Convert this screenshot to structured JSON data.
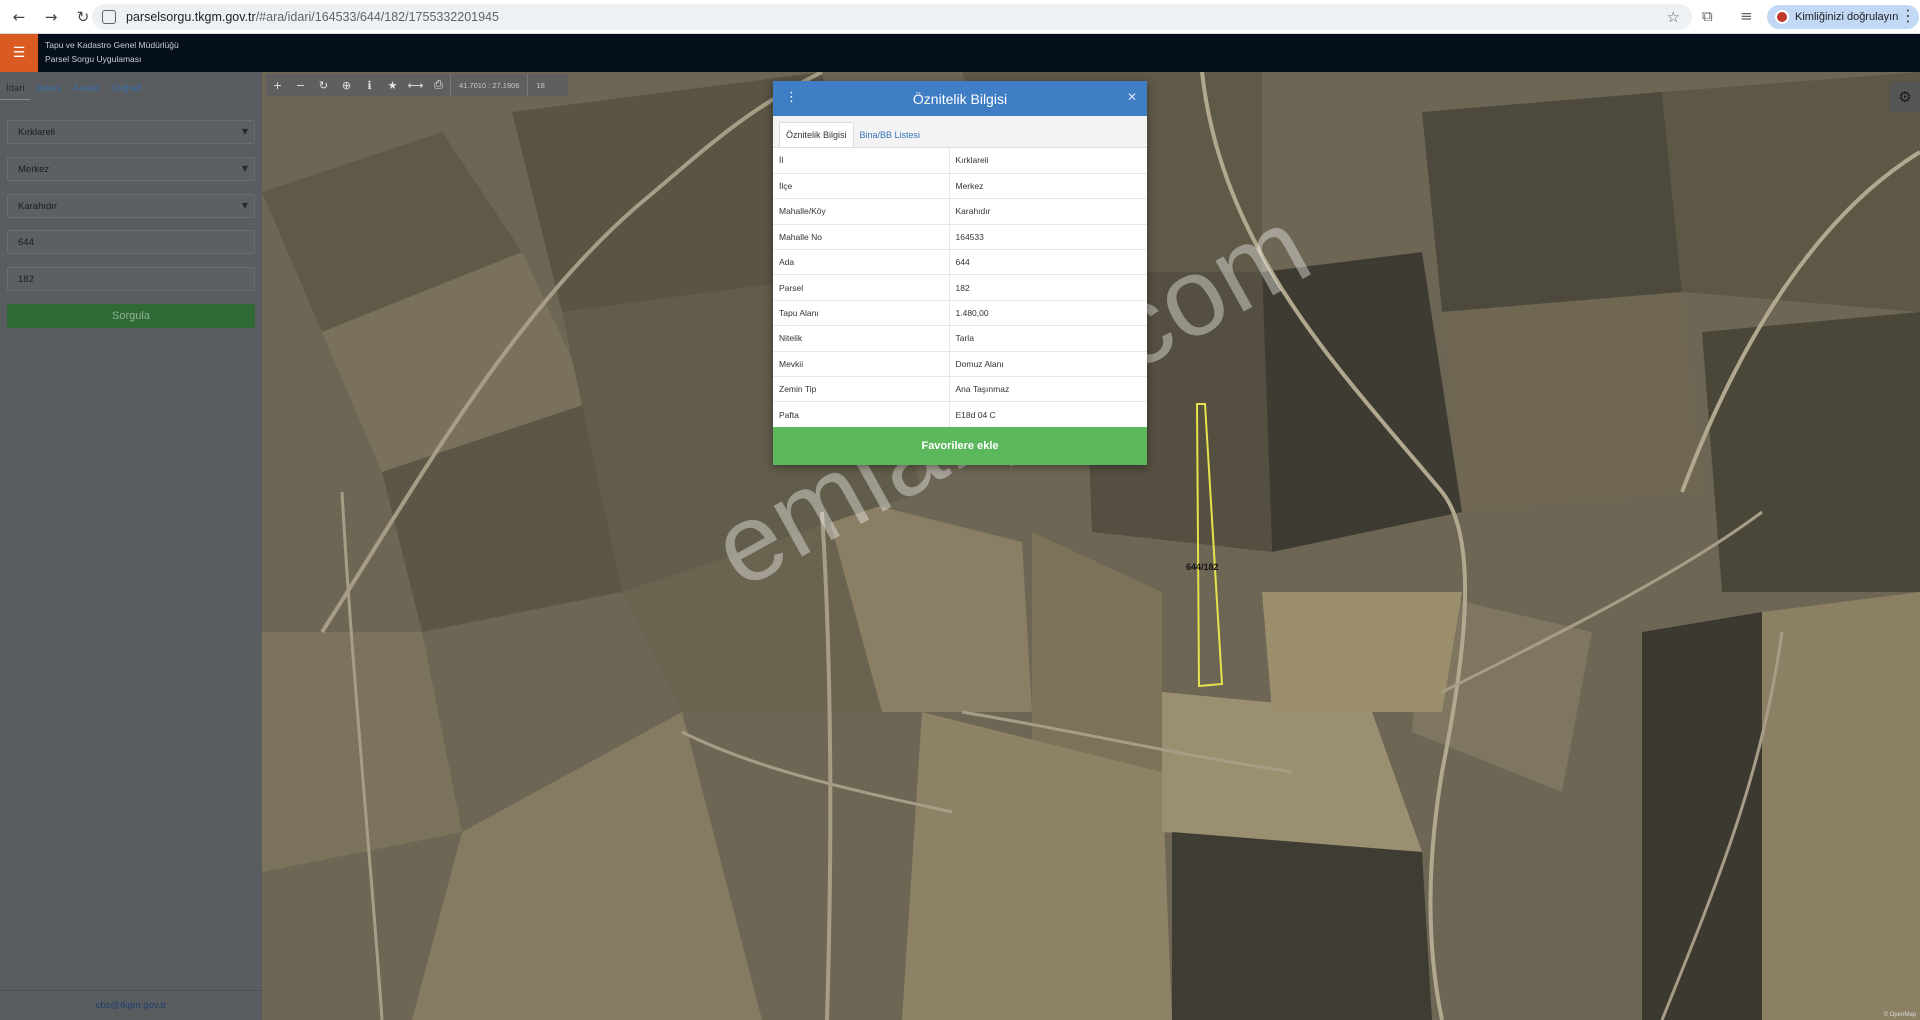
{
  "browser": {
    "url_host": "parselsorgu.tkgm.gov.tr",
    "url_path": "/#ara/idari/164533/644/182/1755332201945",
    "profile_label": "Kimliğinizi doğrulayın"
  },
  "header": {
    "line1": "Tapu ve Kadastro Genel Müdürlüğü",
    "line2": "Parsel Sorgu Uygulaması"
  },
  "sidebar": {
    "tabs": [
      "İdari",
      "Adres",
      "Analiz",
      "Coğrafi"
    ],
    "fields": {
      "il": "Kırklareli",
      "ilce": "Merkez",
      "mahalle": "Karahıdır",
      "ada": "644",
      "parsel": "182"
    },
    "query_label": "Sorgula",
    "footer_email": "cbs@tkgm.gov.tr"
  },
  "map": {
    "coords": "41.7010 : 27.1906",
    "zoom": "18",
    "parcel_label": "644/182",
    "watermark": "emlakjet.com",
    "attribution": "© OpenMap"
  },
  "dialog": {
    "title": "Öznitelik Bilgisi",
    "tabs": [
      "Öznitelik Bilgisi",
      "Bina/BB Listesi"
    ],
    "rows": [
      {
        "key": "İl",
        "value": "Kırklareli"
      },
      {
        "key": "İlçe",
        "value": "Merkez"
      },
      {
        "key": "Mahalle/Köy",
        "value": "Karahıdır"
      },
      {
        "key": "Mahalle No",
        "value": "164533"
      },
      {
        "key": "Ada",
        "value": "644"
      },
      {
        "key": "Parsel",
        "value": "182"
      },
      {
        "key": "Tapu Alanı",
        "value": "1.480,00"
      },
      {
        "key": "Nitelik",
        "value": "Tarla"
      },
      {
        "key": "Mevkii",
        "value": "Domuz Alanı"
      },
      {
        "key": "Zemin Tip",
        "value": "Ana Taşınmaz"
      },
      {
        "key": "Pafta",
        "value": "E18d 04 C"
      }
    ],
    "favorite_label": "Favorilere ekle"
  }
}
